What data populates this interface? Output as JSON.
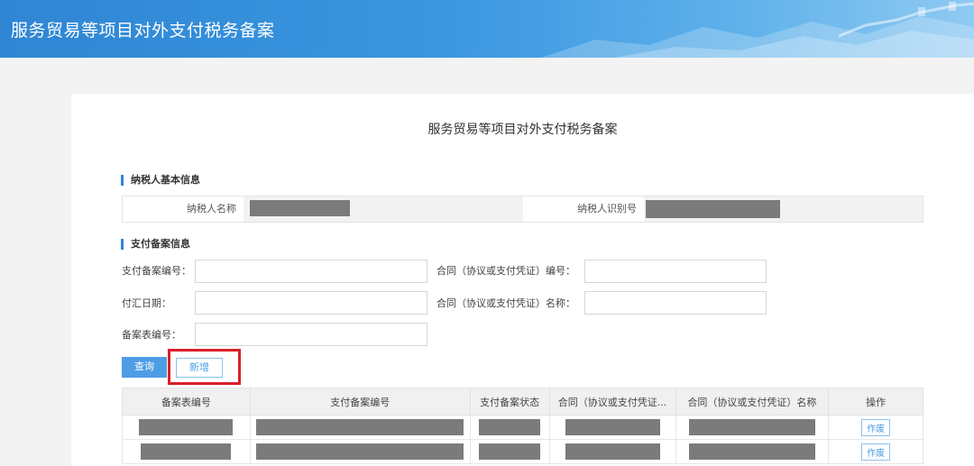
{
  "banner": {
    "title": "服务贸易等项目对外支付税务备案"
  },
  "page": {
    "title": "服务贸易等项目对外支付税务备案"
  },
  "taxpayer_section": {
    "title": "纳税人基本信息",
    "name_label": "纳税人名称",
    "id_label": "纳税人识别号"
  },
  "payment_section": {
    "title": "支付备案信息",
    "fields": {
      "filing_no_label": "支付备案编号：",
      "contract_no_label": "合同（协议或支付凭证）编号：",
      "remit_date_label": "付汇日期：",
      "contract_name_label": "合同（协议或支付凭证）名称：",
      "form_no_label": "备案表编号："
    }
  },
  "buttons": {
    "query": "查询",
    "add": "新增"
  },
  "table": {
    "headers": [
      "备案表编号",
      "支付备案编号",
      "支付备案状态",
      "合同（协议或支付凭证...",
      "合同（协议或支付凭证）名称",
      "操作"
    ],
    "row_action": "作废"
  },
  "colors": {
    "accent": "#2f86d3",
    "button": "#4e9de4",
    "highlight": "#d9202a",
    "redaction": "#7b7b7b"
  }
}
